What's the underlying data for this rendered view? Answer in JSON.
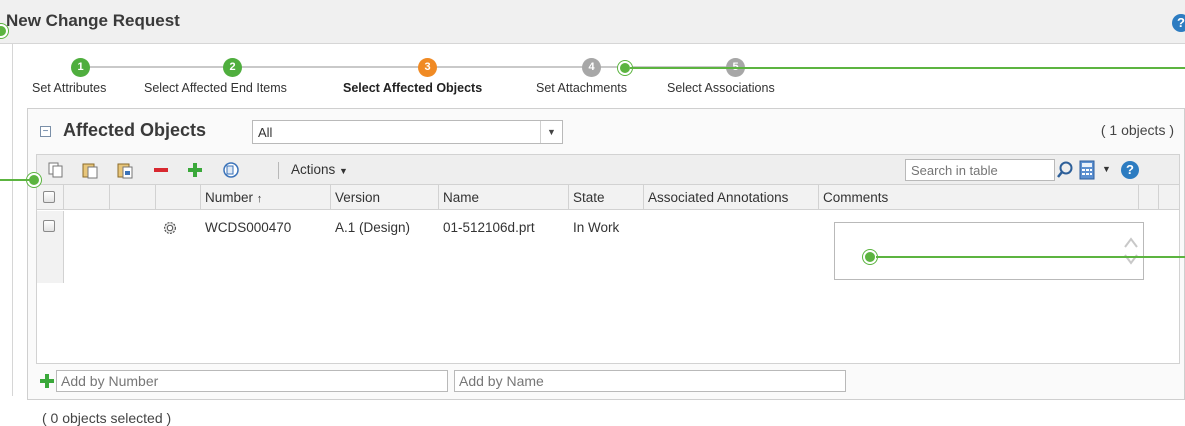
{
  "window": {
    "title": "New Change Request"
  },
  "steps": [
    {
      "number": "1",
      "label": "Set Attributes",
      "state": "done"
    },
    {
      "number": "2",
      "label": "Select Affected End Items",
      "state": "done"
    },
    {
      "number": "3",
      "label": "Select Affected Objects",
      "state": "current"
    },
    {
      "number": "4",
      "label": "Set Attachments",
      "state": "future"
    },
    {
      "number": "5",
      "label": "Select Associations",
      "state": "future"
    }
  ],
  "panel": {
    "title": "Affected Objects",
    "filter_value": "All",
    "object_count": "( 1 objects )"
  },
  "toolbar": {
    "actions_label": "Actions",
    "search_placeholder": "Search in table",
    "icons": [
      "copy-icon",
      "paste-icon",
      "paste-special-icon",
      "remove-icon",
      "add-icon",
      "insert-icon",
      "search-icon",
      "calculator-icon",
      "help-icon"
    ]
  },
  "table": {
    "columns": [
      "Number",
      "Version",
      "Name",
      "State",
      "Associated Annotations",
      "Comments"
    ],
    "sort_indicator": "↑",
    "rows": [
      {
        "number": "WCDS000470",
        "version": "A.1 (Design)",
        "name": "01-512106d.prt",
        "state": "In Work",
        "associated_annotations": "",
        "comments": ""
      }
    ]
  },
  "add_by": {
    "number_placeholder": "Add by Number",
    "name_placeholder": "Add by Name"
  },
  "status": {
    "selected_text": "( 0 objects selected )"
  },
  "colors": {
    "callout": "#5cb440",
    "step_done": "#4fae3e",
    "step_current": "#f08a24",
    "step_future": "#a7a7a7",
    "help": "#2d7cc1"
  }
}
